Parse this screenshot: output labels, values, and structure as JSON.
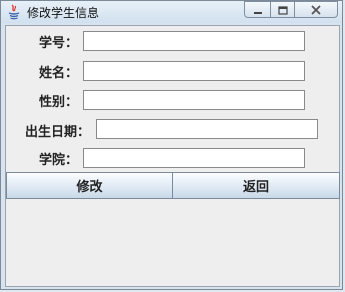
{
  "window": {
    "title": "修改学生信息",
    "controls": {
      "minimize_icon": "minimize-icon",
      "maximize_icon": "maximize-icon",
      "close_icon": "close-icon"
    }
  },
  "form": {
    "student_id": {
      "label": "学号：",
      "value": ""
    },
    "name": {
      "label": "姓名：",
      "value": ""
    },
    "gender": {
      "label": "性别：",
      "value": ""
    },
    "birth_date": {
      "label": "出生日期：",
      "value": ""
    },
    "college": {
      "label": "学院：",
      "value": ""
    }
  },
  "buttons": {
    "modify_label": "修改",
    "back_label": "返回"
  },
  "colors": {
    "window_bg": "#eeeeee",
    "titlebar": "#d2e1ef",
    "close_x": "#555555"
  }
}
